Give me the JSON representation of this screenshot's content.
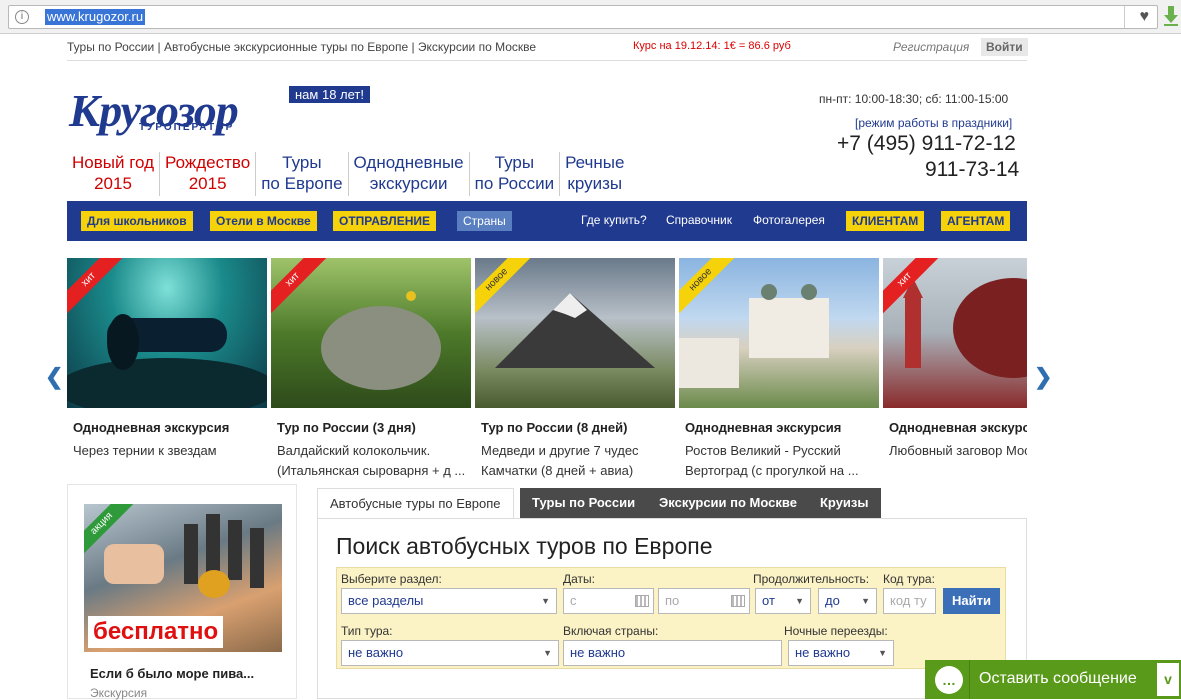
{
  "browser": {
    "url": "www.krugozor.ru"
  },
  "topline": {
    "links": "Туры по России | Автобусные экскурсионные туры по Европе | Экскурсии по Москве",
    "rate": "Курс на 19.12.14: 1€ = 86.6 руб",
    "register": "Регистрация",
    "login": "Войти"
  },
  "logo": {
    "main": "Кругозор",
    "sub": "ТУРОПЕРАТОР",
    "badge": "нам 18 лет!"
  },
  "contacts": {
    "hours": "пн-пт: 10:00-18:30; сб: 11:00-15:00",
    "holiday": "[режим работы в праздники]",
    "phone1": "+7 (495) 911-72-12",
    "phone2": "911-73-14"
  },
  "categories": [
    {
      "line1": "Новый год",
      "line2": "2015",
      "color": "#d00000"
    },
    {
      "line1": "Рождество",
      "line2": "2015",
      "color": "#d00000"
    },
    {
      "line1": "Туры",
      "line2": "по Европе",
      "color": "#203a8f"
    },
    {
      "line1": "Однодневные",
      "line2": "экскурсии",
      "color": "#203a8f"
    },
    {
      "line1": "Туры",
      "line2": "по России",
      "color": "#203a8f"
    },
    {
      "line1": "Речные",
      "line2": "круизы",
      "color": "#203a8f"
    }
  ],
  "bluebar": {
    "btn_schoolkids": "Для школьников",
    "btn_hotels": "Отели в Москве",
    "btn_departure": "ОТПРАВЛЕНИЕ",
    "btn_countries": "Страны",
    "link_where": "Где купить?",
    "link_reference": "Справочник",
    "link_gallery": "Фотогалерея",
    "btn_clients": "КЛИЕНТАМ",
    "btn_agents": "АГЕНТАМ"
  },
  "slides": [
    {
      "ribbon": "хит",
      "title": "Однодневная экскурсия",
      "desc1": "Через тернии к звездам",
      "desc2": ""
    },
    {
      "ribbon": "хит",
      "title": "Тур по России (3 дня)",
      "desc1": "Валдайский колокольчик.",
      "desc2": "(Итальянская сыроварня + д ..."
    },
    {
      "ribbon": "новое",
      "title": "Тур по России (8 дней)",
      "desc1": "Медведи и другие 7 чудес",
      "desc2": "Камчатки (8 дней + авиа)"
    },
    {
      "ribbon": "новое",
      "title": "Однодневная экскурсия",
      "desc1": "Ростов Великий - Русский",
      "desc2": "Вертоград (с прогулкой на ..."
    },
    {
      "ribbon": "хит",
      "title": "Однодневная экскурсия",
      "desc1": "Любовный заговор Москвы",
      "desc2": ""
    }
  ],
  "promo": {
    "ribbon": "акция",
    "free": "бесплатно",
    "title": "Если б было море пива...",
    "sub": "Экскурсия"
  },
  "tabs": [
    "Автобусные туры по Европе",
    "Туры по России",
    "Экскурсии по Москве",
    "Круизы"
  ],
  "search": {
    "title": "Поиск автобусных туров по Европе",
    "section_label": "Выберите раздел:",
    "section_value": "все разделы",
    "dates_label": "Даты:",
    "date_from_ph": "с",
    "date_to_ph": "по",
    "duration_label": "Продолжительность:",
    "dur_from": "от",
    "dur_to": "до",
    "code_label": "Код тура:",
    "code_ph": "код ту",
    "find": "Найти",
    "type_label": "Тип тура:",
    "type_value": "не важно",
    "countries_label": "Включая страны:",
    "countries_value": "не важно",
    "night_label": "Ночные переезды:",
    "night_value": "не важно"
  },
  "chat": {
    "text": "Оставить сообщение",
    "min": "v"
  }
}
